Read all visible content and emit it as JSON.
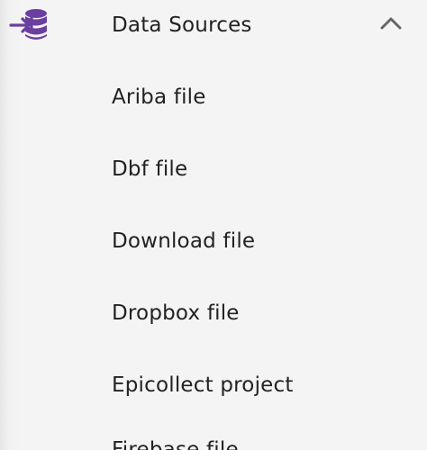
{
  "header": {
    "icon": "database-import-icon",
    "label": "Data Sources",
    "toggle_icon": "chevron-up-icon",
    "accent": "#6b3fa0"
  },
  "items": [
    {
      "label": "Ariba file"
    },
    {
      "label": "Dbf file"
    },
    {
      "label": "Download file"
    },
    {
      "label": "Dropbox file"
    },
    {
      "label": "Epicollect project"
    },
    {
      "label": "Firebase file"
    }
  ]
}
